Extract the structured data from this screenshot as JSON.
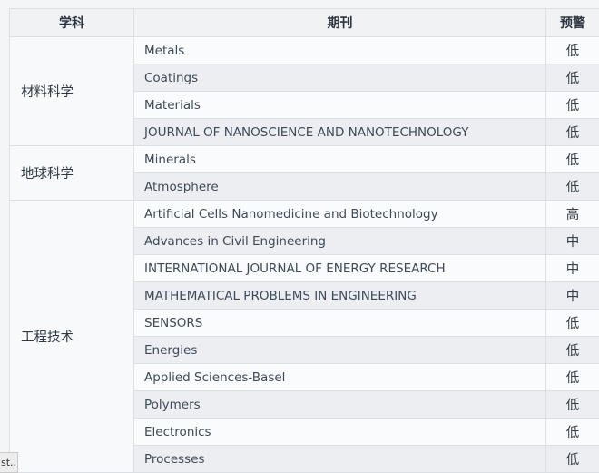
{
  "table": {
    "headers": {
      "subject": "学科",
      "journal": "期刊",
      "warning": "预警"
    },
    "groups": [
      {
        "subject": "材料科学",
        "rows": [
          {
            "journal": "Metals",
            "warning": "低"
          },
          {
            "journal": "Coatings",
            "warning": "低"
          },
          {
            "journal": "Materials",
            "warning": "低"
          },
          {
            "journal": "JOURNAL OF NANOSCIENCE AND NANOTECHNOLOGY",
            "warning": "低"
          }
        ]
      },
      {
        "subject": "地球科学",
        "rows": [
          {
            "journal": "Minerals",
            "warning": "低"
          },
          {
            "journal": "Atmosphere",
            "warning": "低"
          }
        ]
      },
      {
        "subject": "工程技术",
        "rows": [
          {
            "journal": "Artificial Cells Nanomedicine and Biotechnology",
            "warning": "高"
          },
          {
            "journal": "Advances in Civil Engineering",
            "warning": "中"
          },
          {
            "journal": "INTERNATIONAL JOURNAL OF ENERGY RESEARCH",
            "warning": "中"
          },
          {
            "journal": "MATHEMATICAL PROBLEMS IN ENGINEERING",
            "warning": "中"
          },
          {
            "journal": "SENSORS",
            "warning": "低"
          },
          {
            "journal": "Energies",
            "warning": "低"
          },
          {
            "journal": "Applied Sciences-Basel",
            "warning": "低"
          },
          {
            "journal": "Polymers",
            "warning": "低"
          },
          {
            "journal": "Electronics",
            "warning": "低"
          },
          {
            "journal": "Processes",
            "warning": "低"
          }
        ]
      }
    ]
  },
  "tooltip": {
    "text": "st..."
  }
}
